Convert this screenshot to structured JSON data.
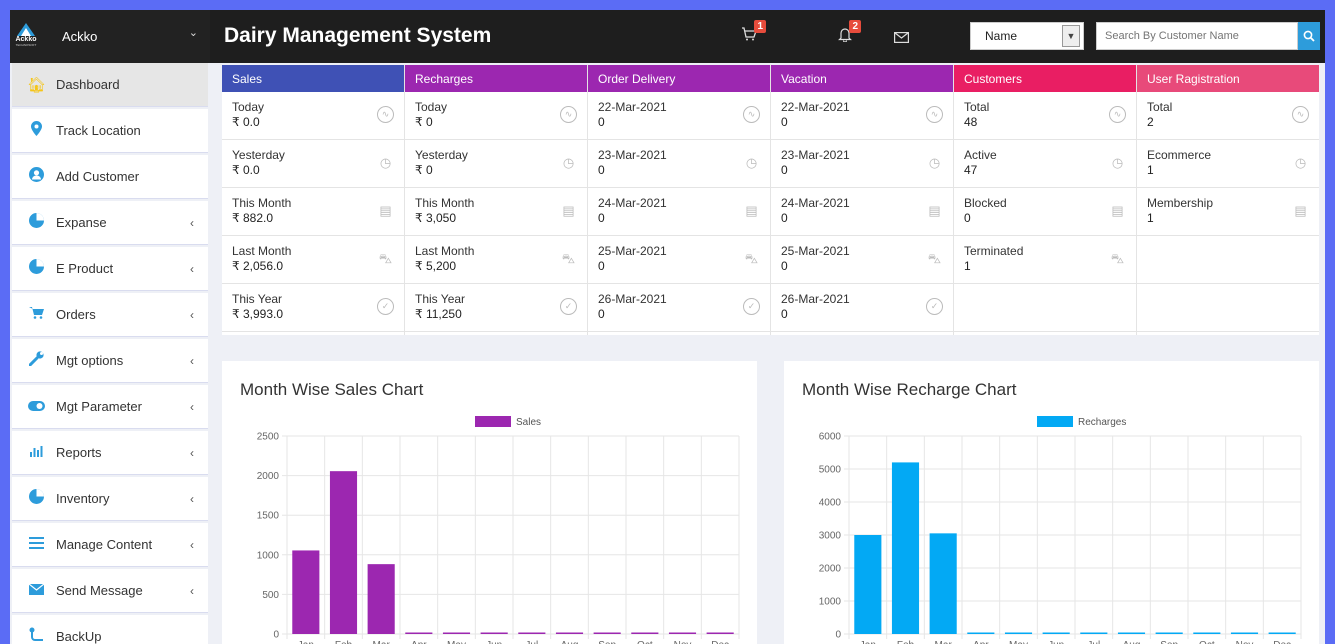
{
  "header": {
    "brand_name": "Ackko",
    "logo_text": "Ackko",
    "logo_sub": "TECHNOSOFT",
    "app_title": "Dairy Management System",
    "cart_badge": "1",
    "bell_badge": "2",
    "select_value": "Name",
    "search_placeholder": "Search By Customer Name"
  },
  "sidebar": {
    "items": [
      {
        "label": "Dashboard",
        "icon": "home-icon"
      },
      {
        "label": "Track Location",
        "icon": "map-pin-icon"
      },
      {
        "label": "Add Customer",
        "icon": "user-icon"
      },
      {
        "label": "Expanse",
        "icon": "pie-icon"
      },
      {
        "label": "E Product",
        "icon": "pie-icon"
      },
      {
        "label": "Orders",
        "icon": "cart-icon"
      },
      {
        "label": "Mgt options",
        "icon": "wrench-icon"
      },
      {
        "label": "Mgt Parameter",
        "icon": "toggle-icon"
      },
      {
        "label": "Reports",
        "icon": "bar-chart-icon"
      },
      {
        "label": "Inventory",
        "icon": "pie-icon"
      },
      {
        "label": "Manage Content",
        "icon": "menu-icon"
      },
      {
        "label": "Send Message",
        "icon": "envelope-icon"
      },
      {
        "label": "BackUp",
        "icon": "backup-icon"
      }
    ]
  },
  "stats": {
    "columns": [
      {
        "title": "Sales",
        "color": "#3f51b5",
        "rows": [
          {
            "label": "Today",
            "value": "₹ 0.0",
            "icon": "chart-icon"
          },
          {
            "label": "Yesterday",
            "value": "₹ 0.0",
            "icon": "clock-icon"
          },
          {
            "label": "This Month",
            "value": "₹ 882.0",
            "icon": "calendar-icon"
          },
          {
            "label": "Last Month",
            "value": "₹ 2,056.0",
            "icon": "cart-icon"
          },
          {
            "label": "This Year",
            "value": "₹ 3,993.0",
            "icon": "check-icon"
          }
        ]
      },
      {
        "title": "Recharges",
        "color": "#9c27b0",
        "rows": [
          {
            "label": "Today",
            "value": "₹ 0",
            "icon": "chart-icon"
          },
          {
            "label": "Yesterday",
            "value": "₹ 0",
            "icon": "clock-icon"
          },
          {
            "label": "This Month",
            "value": "₹ 3,050",
            "icon": "calendar-icon"
          },
          {
            "label": "Last Month",
            "value": "₹ 5,200",
            "icon": "cart-icon"
          },
          {
            "label": "This Year",
            "value": "₹ 11,250",
            "icon": "check-icon"
          }
        ]
      },
      {
        "title": "Order Delivery",
        "color": "#9c27b0",
        "rows": [
          {
            "label": "22-Mar-2021",
            "value": "0",
            "icon": "chart-icon"
          },
          {
            "label": "23-Mar-2021",
            "value": "0",
            "icon": "clock-icon"
          },
          {
            "label": "24-Mar-2021",
            "value": "0",
            "icon": "calendar-icon"
          },
          {
            "label": "25-Mar-2021",
            "value": "0",
            "icon": "cart-icon"
          },
          {
            "label": "26-Mar-2021",
            "value": "0",
            "icon": "check-icon"
          }
        ]
      },
      {
        "title": "Vacation",
        "color": "#9c27b0",
        "rows": [
          {
            "label": "22-Mar-2021",
            "value": "0",
            "icon": "chart-icon"
          },
          {
            "label": "23-Mar-2021",
            "value": "0",
            "icon": "clock-icon"
          },
          {
            "label": "24-Mar-2021",
            "value": "0",
            "icon": "calendar-icon"
          },
          {
            "label": "25-Mar-2021",
            "value": "0",
            "icon": "cart-icon"
          },
          {
            "label": "26-Mar-2021",
            "value": "0",
            "icon": "check-icon"
          }
        ]
      },
      {
        "title": "Customers",
        "color": "#e91e63",
        "rows": [
          {
            "label": "Total",
            "value": "48",
            "icon": "chart-icon"
          },
          {
            "label": "Active",
            "value": "47",
            "icon": "clock-icon"
          },
          {
            "label": "Blocked",
            "value": "0",
            "icon": "calendar-icon"
          },
          {
            "label": "Terminated",
            "value": "1",
            "icon": "cart-icon"
          },
          {
            "label": "",
            "value": "",
            "icon": ""
          }
        ]
      },
      {
        "title": "User Ragistration",
        "color": "#e84a7a",
        "rows": [
          {
            "label": "Total",
            "value": "2",
            "icon": "chart-icon"
          },
          {
            "label": "Ecommerce",
            "value": "1",
            "icon": "clock-icon"
          },
          {
            "label": "Membership",
            "value": "1",
            "icon": "calendar-icon"
          },
          {
            "label": "",
            "value": "",
            "icon": ""
          },
          {
            "label": "",
            "value": "",
            "icon": ""
          }
        ]
      }
    ]
  },
  "charts": {
    "sales_title": "Month Wise Sales Chart",
    "recharge_title": "Month Wise Recharge Chart"
  },
  "chart_data": [
    {
      "type": "bar",
      "title": "Month Wise Sales Chart",
      "categories": [
        "Jan",
        "Feb",
        "Mar",
        "Apr",
        "May",
        "Jun",
        "Jul",
        "Aug",
        "Sep",
        "Oct",
        "Nov",
        "Dec"
      ],
      "series": [
        {
          "name": "Sales",
          "values": [
            1055,
            2056,
            882,
            0,
            0,
            0,
            0,
            0,
            0,
            0,
            0,
            0
          ]
        }
      ],
      "color": "#9c27b0",
      "ylim": [
        0,
        2500
      ],
      "yticks": [
        0,
        500,
        1000,
        1500,
        2000,
        2500
      ],
      "legend": "top-center",
      "grid": true
    },
    {
      "type": "bar",
      "title": "Month Wise Recharge Chart",
      "categories": [
        "Jan",
        "Feb",
        "Mar",
        "Apr",
        "May",
        "Jun",
        "Jul",
        "Aug",
        "Sep",
        "Oct",
        "Nov",
        "Dec"
      ],
      "series": [
        {
          "name": "Recharges",
          "values": [
            3000,
            5200,
            3050,
            0,
            0,
            0,
            0,
            0,
            0,
            0,
            0,
            0
          ]
        }
      ],
      "color": "#03a9f4",
      "ylim": [
        0,
        6000
      ],
      "yticks": [
        0,
        1000,
        2000,
        3000,
        4000,
        5000,
        6000
      ],
      "legend": "top-center",
      "grid": true
    }
  ]
}
